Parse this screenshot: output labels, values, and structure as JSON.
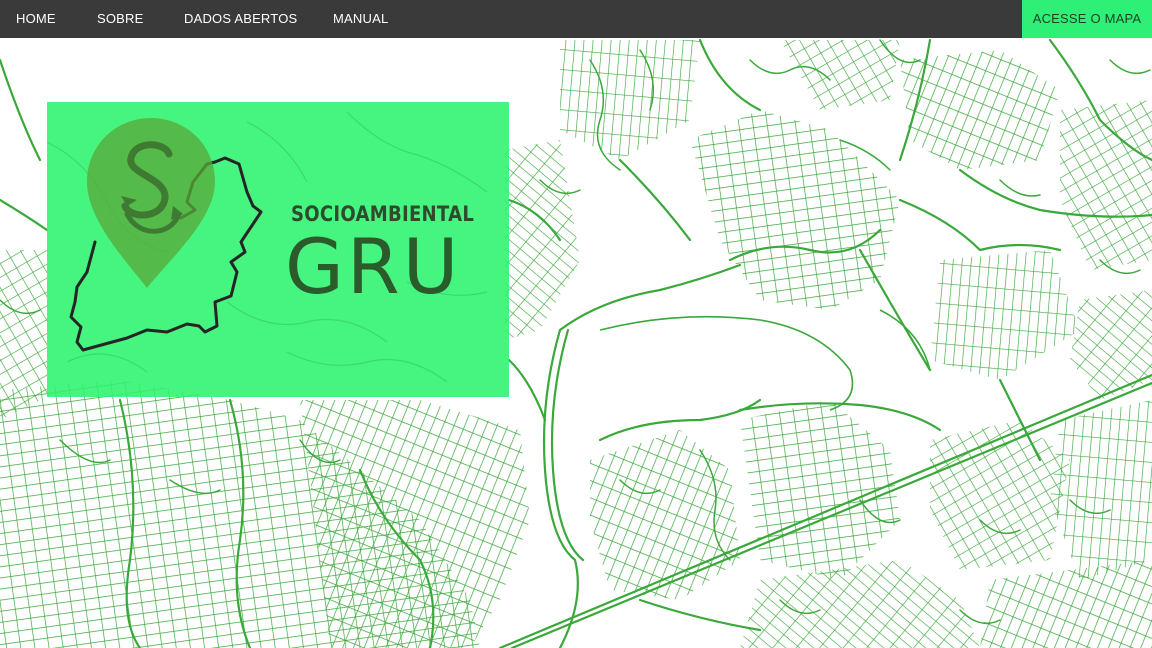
{
  "nav": {
    "items": [
      {
        "label": "HOME"
      },
      {
        "label": "SOBRE"
      },
      {
        "label": "DADOS ABERTOS"
      },
      {
        "label": "MANUAL"
      }
    ],
    "cta_label": "ACESSE O MAPA"
  },
  "hero": {
    "brand_subtitle": "SOCIOAMBIENTAL",
    "brand_title": "GRU",
    "logo_icon": "map-pin-s-recycle-icon",
    "outline_icon": "municipality-outline-icon"
  },
  "colors": {
    "nav_background": "#3a3a3a",
    "accent": "#2ef077",
    "map_lines": "#3aa83a",
    "panel": "#2cf36e",
    "brand_text": "#2f4a2c"
  }
}
